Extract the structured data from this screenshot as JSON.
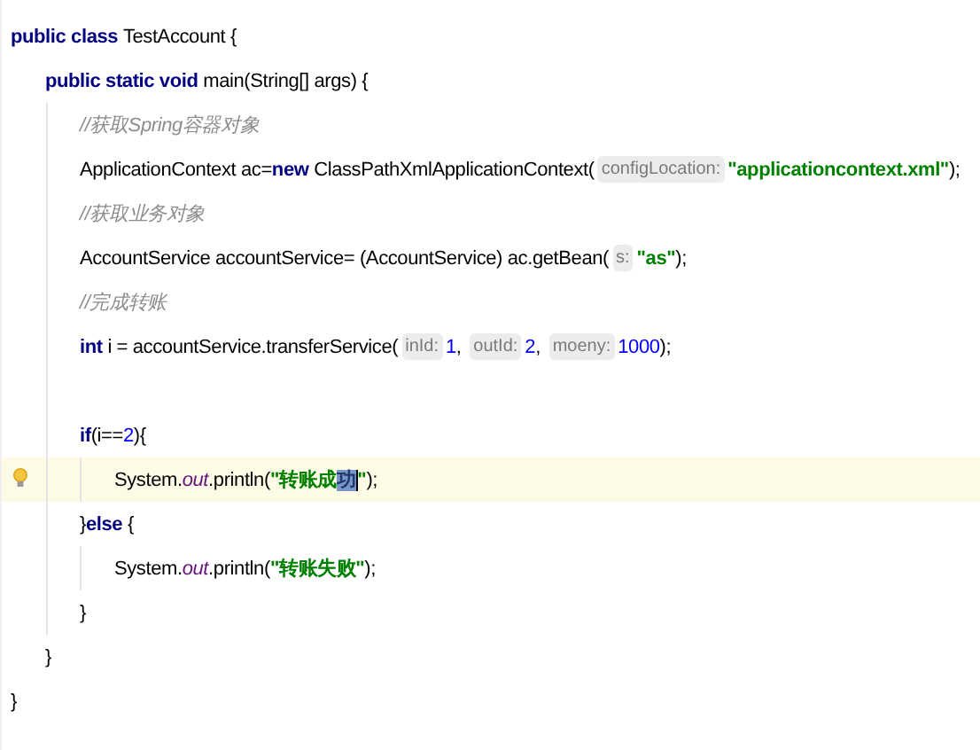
{
  "lines": [
    {
      "current": false,
      "parts": [
        {
          "kind": "keyword",
          "text": "public class "
        },
        {
          "kind": "plain",
          "text": "TestAccount {"
        }
      ],
      "children": [
        {
          "current": false,
          "parts": [
            {
              "kind": "keyword",
              "text": "public static void "
            },
            {
              "kind": "plain",
              "text": "main(String[] args) {"
            }
          ],
          "children": [
            {
              "current": false,
              "parts": [
                {
                  "kind": "comment",
                  "text": "//获取Spring容器对象"
                }
              ]
            },
            {
              "current": false,
              "parts": [
                {
                  "kind": "plain",
                  "text": "ApplicationContext ac="
                },
                {
                  "kind": "keyword",
                  "text": "new "
                },
                {
                  "kind": "plain",
                  "text": "ClassPathXmlApplicationContext("
                },
                {
                  "kind": "hint",
                  "text": "configLocation:"
                },
                {
                  "kind": "string",
                  "text": "\"applicationcontext.xml\""
                },
                {
                  "kind": "plain",
                  "text": ");"
                }
              ]
            },
            {
              "current": false,
              "parts": [
                {
                  "kind": "comment",
                  "text": "//获取业务对象"
                }
              ]
            },
            {
              "current": false,
              "parts": [
                {
                  "kind": "plain",
                  "text": "AccountService accountService= (AccountService) ac.getBean("
                },
                {
                  "kind": "hint",
                  "text": "s:"
                },
                {
                  "kind": "string",
                  "text": "\"as\""
                },
                {
                  "kind": "plain",
                  "text": ");"
                }
              ]
            },
            {
              "current": false,
              "parts": [
                {
                  "kind": "comment",
                  "text": "//完成转账"
                }
              ]
            },
            {
              "current": false,
              "parts": [
                {
                  "kind": "keyword",
                  "text": "int "
                },
                {
                  "kind": "plain",
                  "text": "i = accountService.transferService("
                },
                {
                  "kind": "hint",
                  "text": "inId:"
                },
                {
                  "kind": "number",
                  "text": "1"
                },
                {
                  "kind": "plain",
                  "text": ", "
                },
                {
                  "kind": "hint",
                  "text": "outId:"
                },
                {
                  "kind": "number",
                  "text": "2"
                },
                {
                  "kind": "plain",
                  "text": ", "
                },
                {
                  "kind": "hint",
                  "text": "moeny:"
                },
                {
                  "kind": "number",
                  "text": "1000"
                },
                {
                  "kind": "plain",
                  "text": ");"
                }
              ]
            },
            {
              "current": false
            },
            {
              "current": false,
              "parts": [
                {
                  "kind": "keyword",
                  "text": "if"
                },
                {
                  "kind": "plain",
                  "text": "(i=="
                },
                {
                  "kind": "number",
                  "text": "2"
                },
                {
                  "kind": "plain",
                  "text": "){"
                }
              ],
              "children": [
                {
                  "current": true,
                  "parts": [
                    {
                      "kind": "plain",
                      "text": "System."
                    },
                    {
                      "kind": "field",
                      "text": "out"
                    },
                    {
                      "kind": "plain",
                      "text": ".println("
                    },
                    {
                      "kind": "string",
                      "text": "\"转账成"
                    },
                    {
                      "kind": "selection",
                      "text": "功"
                    },
                    {
                      "kind": "string",
                      "text": "\""
                    },
                    {
                      "kind": "plain",
                      "text": ");"
                    }
                  ]
                }
              ]
            },
            {
              "current": false,
              "parts": [
                {
                  "kind": "plain",
                  "text": "}"
                },
                {
                  "kind": "keyword",
                  "text": "else "
                },
                {
                  "kind": "plain",
                  "text": "{"
                }
              ],
              "children": [
                {
                  "current": false,
                  "parts": [
                    {
                      "kind": "plain",
                      "text": "System."
                    },
                    {
                      "kind": "field",
                      "text": "out"
                    },
                    {
                      "kind": "plain",
                      "text": ".println("
                    },
                    {
                      "kind": "string",
                      "text": "\"转账失败\""
                    },
                    {
                      "kind": "plain",
                      "text": ");"
                    }
                  ]
                }
              ]
            },
            {
              "current": false,
              "parts": [
                {
                  "kind": "plain",
                  "text": "}"
                }
              ]
            }
          ]
        },
        {
          "current": false,
          "parts": [
            {
              "kind": "plain",
              "text": "}"
            }
          ]
        }
      ]
    },
    {
      "current": false,
      "parts": [
        {
          "kind": "plain",
          "text": "}"
        }
      ]
    }
  ]
}
